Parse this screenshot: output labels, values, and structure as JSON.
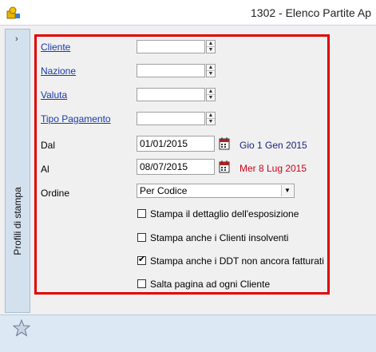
{
  "window": {
    "title": "1302 - Elenco Partite Ap"
  },
  "side_panel": {
    "chevron": "›",
    "label": "Profili di stampa"
  },
  "form": {
    "cliente": {
      "label": "Cliente",
      "value": ""
    },
    "nazione": {
      "label": "Nazione",
      "value": ""
    },
    "valuta": {
      "label": "Valuta",
      "value": ""
    },
    "tipo_pagamento": {
      "label": "Tipo Pagamento",
      "value": ""
    },
    "dal": {
      "label": "Dal",
      "value": "01/01/2015",
      "text": "Gio 1 Gen 2015",
      "text_color": "#1a237e"
    },
    "al": {
      "label": "Al",
      "value": "08/07/2015",
      "text": "Mer 8 Lug 2015",
      "text_color": "#d0021b"
    },
    "ordine": {
      "label": "Ordine",
      "selected": "Per Codice"
    },
    "checkboxes": [
      {
        "label": "Stampa il dettaglio dell'esposizione",
        "checked": false
      },
      {
        "label": "Stampa anche i Clienti insolventi",
        "checked": false
      },
      {
        "label": "Stampa anche i DDT non ancora fatturati",
        "checked": true
      },
      {
        "label": "Salta pagina ad ogni Cliente",
        "checked": false
      }
    ]
  },
  "colors": {
    "highlight": "#e00000",
    "link": "#1a3aa8"
  },
  "icons": {
    "app": "app-icon",
    "calendar": "calendar-icon",
    "favorite": "star-icon"
  }
}
